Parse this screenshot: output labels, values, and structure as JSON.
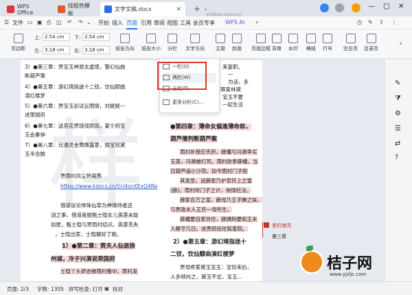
{
  "tabs": [
    {
      "label": "WPS Office",
      "color": "#d9373b"
    },
    {
      "label": "找稻壳模板",
      "color": "#e05a2b"
    },
    {
      "label": "文字文稿.docx",
      "color": "#2b6ee5"
    }
  ],
  "url_fragment": "xinghuo.xyun.cn/",
  "menu": {
    "file": "文件",
    "items": [
      "开始",
      "插入",
      "页面",
      "引用",
      "审阅",
      "视图",
      "工具",
      "会员专享"
    ],
    "active": "页面",
    "wps_ai": "WPS AI"
  },
  "ribbon": {
    "margins": {
      "label": "页边距",
      "top_label": "上:",
      "top": "2.54",
      "bottom_label": "下:",
      "bottom": "2.54",
      "left_label": "左:",
      "left": "3.18",
      "right_label": "右:",
      "right": "3.18",
      "unit": "cm"
    },
    "orientation": "纸张方向",
    "size": "纸张大小",
    "columns": "分栏",
    "text_direction": "文字方向",
    "theme": "主题",
    "cover": "封面",
    "page_border": "页面边框",
    "background": "背景",
    "watermark": "水印",
    "manuscript": "稿纸",
    "line_number": "行号",
    "blank_page": "空白页",
    "toc_page": "目录页"
  },
  "columns_menu": {
    "items": [
      "一栏(O)",
      "两栏(W)",
      "三栏(T)",
      "更多分栏(C)..."
    ],
    "highlighted": "两栏(W)"
  },
  "doc_left": {
    "lines": [
      "3）●第三章：贾宝玉神游太虚境，警幻仙曲",
      "断葫芦案",
      "4）●第五章：游幻境指迷十二钗，饮仙醪曲",
      "演红楼梦",
      "5）●第六章：贾宝玉初试云雨情，刘姥姥一",
      "进荣国府",
      "6）●第七章：送宫花贾琏戏熙凤，宴宁府宝",
      "玉会秦钟",
      "7）●第八章：比通灵金莺微露意，探宝钗黛",
      "玉半含酸"
    ],
    "source_label": "贾雨村风尘怀闺秀",
    "link": "https://www.kdocs.cn/l/ci4snXExQ4Re",
    "paragraph": [
      "借道谈论绛珠仙草为神瑛侍者还",
      "泪之事，借道度脱甄士隐女儿英莲未能",
      "如愿，甄士隐与贾雨村结识。英莲丢失",
      "，士隐出家，士隐解好了歌。"
    ],
    "chapter_heading": "1）●第二章：贾夫人仙逝扬",
    "chapter_heading2": "州城，冷子兴演说荣国府",
    "last_line": "士隐丫头娇杏被雨村看中。雨村发"
  },
  "doc_right": {
    "top_lines": [
      "来复职。",
      "一",
      "为话，多",
      "竹笔等爱林黛",
      "宝玉不要",
      "一起生活"
    ],
    "heading": [
      "●第四章：薄命女偏逢薄命郎，",
      "葫芦僧判断葫芦案"
    ],
    "paragraph": [
      "雨村补授应天府，薛蟠与冯渊争买",
      "玉莲，冯渊被打死。雨村欲拿薛蟠，当",
      "日葫芦庙小沙弥。如今雨村门子阻",
      "其发签，说薛家乃护官符上之雪",
      "(薛)。雨村听门子之计，徇情枉法。",
      "薛家百万之富，薛母乃王子腾之妹，",
      "与贾政夫人王氏一母所生。",
      "薛蟠要自家另住，薛姨妈要和王夫",
      "人厮守几日。进贾府后住梨香院。"
    ],
    "heading2": [
      "2）●第五章：游幻境指迷十",
      "二钗，饮仙醪曲演红楼梦"
    ],
    "paragraph2": [
      "贾母疼爱黛玉宝玉：宝钗来后，",
      "人多倾向之，黛玉不忿，宝玉..."
    ]
  },
  "comment": {
    "author": "爱的港湾",
    "text": "第三章"
  },
  "watermark_text": "样",
  "logo": {
    "text": "桔子网",
    "url": "www.yjzljc.com"
  },
  "status": {
    "page": "页面: 2/3",
    "words": "字数: 1305",
    "spell": "拼写检查: 打开",
    "proof": "校对"
  }
}
